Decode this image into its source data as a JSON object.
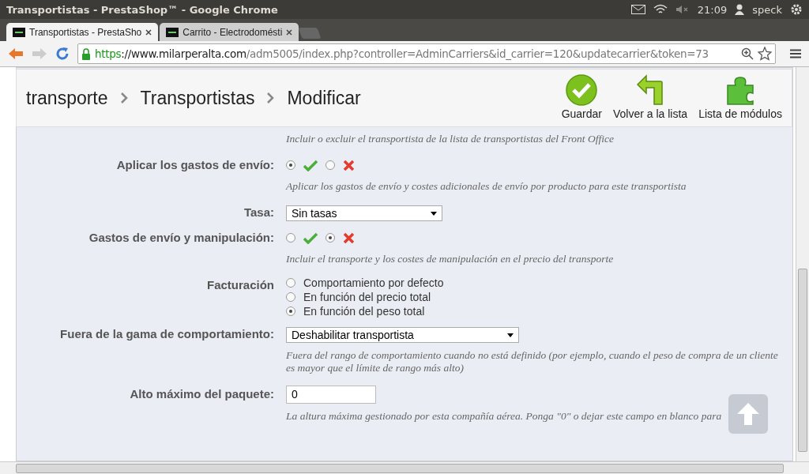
{
  "window": {
    "title": "Transportistas - PrestaShop™ - Google Chrome"
  },
  "tray": {
    "time": "21:09",
    "user": "speck"
  },
  "tabs": [
    {
      "label": "Transportistas - PrestaSho",
      "selected": true
    },
    {
      "label": "Carrito - Electrodomésti",
      "selected": false
    }
  ],
  "address": {
    "scheme": "https",
    "host": "://www.milarperalta.com",
    "path": "/adm5005/index.php?controller=AdminCarriers&id_carrier=120&updatecarrier&token=73"
  },
  "breadcrumb": [
    "transporte",
    "Transportistas",
    "Modificar"
  ],
  "toolbar_buttons": [
    {
      "label": "Guardar",
      "kind": "save"
    },
    {
      "label": "Volver a la lista",
      "kind": "back"
    },
    {
      "label": "Lista de módulos",
      "kind": "modules"
    }
  ],
  "fields": [
    {
      "kind": "note",
      "description": "Incluir o excluir el transportista de la lista de transportistas del Front Office"
    },
    {
      "kind": "yesno",
      "label": "Aplicar los gastos de envío:",
      "enabled": true,
      "description": "Aplicar los gastos de envío y costes adicionales de envío por producto para este transportista"
    },
    {
      "kind": "select",
      "label": "Tasa:",
      "value": "Sin tasas"
    },
    {
      "kind": "yesno",
      "label": "Gastos de envío y manipulación:",
      "enabled": false,
      "description": "Incluir el transporte y los costes de manipulación en el precio del transporte"
    },
    {
      "kind": "radios",
      "label": "Facturación",
      "options": [
        {
          "label": "Comportamiento por defecto",
          "selected": false
        },
        {
          "label": "En función del precio total",
          "selected": false
        },
        {
          "label": "En función del peso total",
          "selected": true
        }
      ]
    },
    {
      "kind": "select",
      "label": "Fuera de la gama de comportamiento:",
      "value": "Deshabilitar transportista",
      "description": "Fuera del rango de comportamiento cuando no está definido (por ejemplo, cuando el peso de compra de un cliente es mayor que el límite de rango más alto)"
    },
    {
      "kind": "text",
      "label": "Alto máximo del paquete:",
      "value": "0",
      "description": "La altura máxima gestionado por esta compañía aérea. Ponga \"0\" o dejar este campo en blanco para"
    }
  ]
}
